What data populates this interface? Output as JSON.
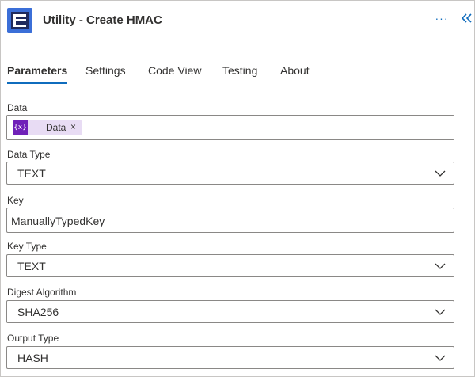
{
  "header": {
    "title": "Utility - Create HMAC",
    "more_label": "···",
    "logo_icon": "app-logo",
    "collapse_icon": "double-chevron-left-icon"
  },
  "tabs": [
    {
      "label": "Parameters",
      "active": true
    },
    {
      "label": "Settings",
      "active": false
    },
    {
      "label": "Code View",
      "active": false
    },
    {
      "label": "Testing",
      "active": false
    },
    {
      "label": "About",
      "active": false
    }
  ],
  "fields": {
    "data": {
      "label": "Data",
      "token_icon": "{x}",
      "token_label": "Data",
      "token_remove": "×"
    },
    "data_type": {
      "label": "Data Type",
      "value": "TEXT"
    },
    "key": {
      "label": "Key",
      "value": "ManuallyTypedKey"
    },
    "key_type": {
      "label": "Key Type",
      "value": "TEXT"
    },
    "digest_algorithm": {
      "label": "Digest Algorithm",
      "value": "SHA256"
    },
    "output_type": {
      "label": "Output Type",
      "value": "HASH"
    }
  },
  "colors": {
    "accent": "#0f6cbd",
    "token_bg": "#e8dcf4",
    "token_icon_bg": "#7021b8",
    "logo_bg": "#3b6fd8"
  }
}
